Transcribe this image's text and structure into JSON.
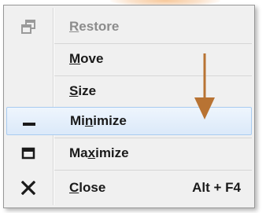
{
  "accent_color": "#b87333",
  "menu": {
    "items": [
      {
        "key": "restore",
        "pre": "",
        "ul": "R",
        "post": "estore",
        "icon": "restore-icon",
        "disabled": true,
        "shortcut": ""
      },
      {
        "key": "move",
        "pre": "",
        "ul": "M",
        "post": "ove",
        "icon": "",
        "disabled": false,
        "shortcut": ""
      },
      {
        "key": "size",
        "pre": "",
        "ul": "S",
        "post": "ize",
        "icon": "",
        "disabled": false,
        "shortcut": ""
      },
      {
        "key": "minimize",
        "pre": "Mi",
        "ul": "n",
        "post": "imize",
        "icon": "minimize-icon",
        "disabled": false,
        "highlighted": true,
        "shortcut": ""
      },
      {
        "key": "maximize",
        "pre": "Ma",
        "ul": "x",
        "post": "imize",
        "icon": "maximize-icon",
        "disabled": false,
        "shortcut": ""
      },
      {
        "key": "close",
        "pre": "",
        "ul": "C",
        "post": "lose",
        "icon": "close-icon",
        "disabled": false,
        "shortcut": "Alt + F4"
      }
    ]
  }
}
